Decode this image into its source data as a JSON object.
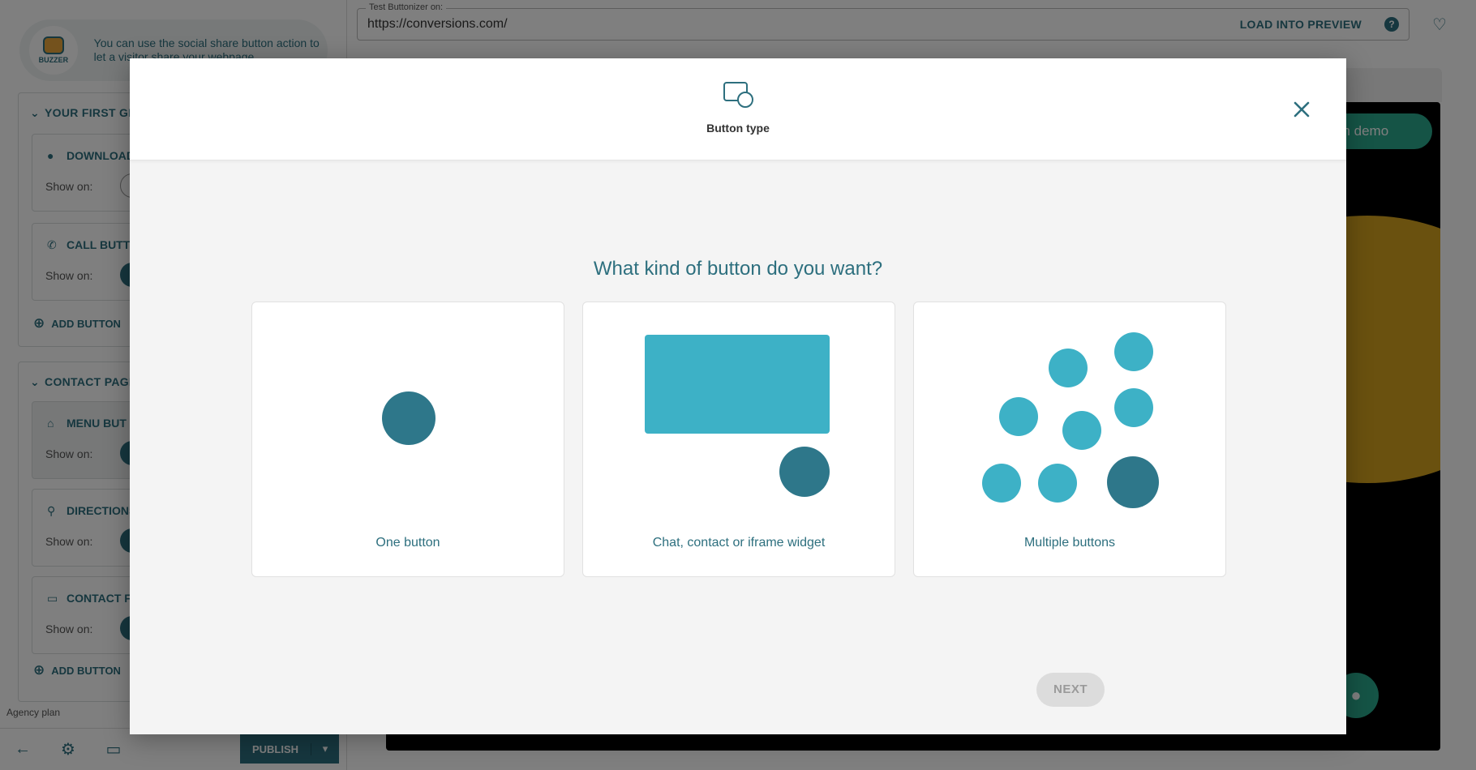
{
  "buzzer": {
    "logo_text": "BUZZER",
    "tip": "You can use the social share button action to let a visitor share your webpage"
  },
  "groups": [
    {
      "title": "YOUR FIRST GR",
      "buttons": [
        {
          "name": "DOWNLOAD",
          "show_on": "Show on:"
        },
        {
          "name": "CALL BUTT",
          "show_on": "Show on:"
        }
      ],
      "add_label": "ADD BUTTON"
    },
    {
      "title": "CONTACT PAGE",
      "buttons": [
        {
          "name": "MENU BUT",
          "show_on": "Show on:"
        },
        {
          "name": "DIRECTIONS",
          "show_on": "Show on:"
        },
        {
          "name": "CONTACT F",
          "show_on": "Show on:"
        }
      ],
      "add_label": "ADD BUTTON"
    }
  ],
  "plan_label": "Agency plan",
  "footer": {
    "publish_label": "PUBLISH"
  },
  "topbar": {
    "legend": "Test Buttonizer on:",
    "url": "https://conversions.com/",
    "load_label": "LOAD INTO PREVIEW"
  },
  "preview": {
    "demo_label": "an demo"
  },
  "modal": {
    "title": "Button type",
    "question": "What kind of button do you want?",
    "options": [
      {
        "label": "One button"
      },
      {
        "label": "Chat, contact or iframe widget"
      },
      {
        "label": "Multiple buttons"
      }
    ],
    "next_label": "NEXT"
  },
  "colors": {
    "accent": "#2d6f7e",
    "dark_dot": "#2e778a",
    "light_dot": "#3db1c6",
    "preview_green": "#2aa88c"
  },
  "icons": {
    "modal_type": "button-type-icon",
    "close": "close-icon",
    "help": "help-icon",
    "bulb": "lightbulb-icon",
    "back": "arrow-left-icon",
    "settings": "gear-icon",
    "desktop": "laptop-icon"
  }
}
